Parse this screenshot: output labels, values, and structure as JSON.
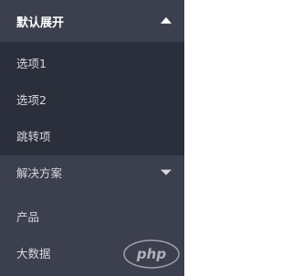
{
  "menu": {
    "group_open": {
      "label": "默认展开",
      "state_icon": "chevron-up-icon",
      "items": [
        {
          "label": "选项1"
        },
        {
          "label": "选项2"
        },
        {
          "label": "跳转项"
        }
      ]
    },
    "group_closed": {
      "label": "解决方案",
      "state_icon": "chevron-down-icon"
    },
    "items": [
      {
        "label": "产品"
      },
      {
        "label": "大数据"
      }
    ]
  },
  "watermark": {
    "text": "php",
    "icon": "php-logo-icon"
  },
  "colors": {
    "menu_bg": "#3c3f4d",
    "submenu_bg": "#2b2e3b",
    "text": "#d7d9df",
    "active_text": "#ffffff"
  }
}
